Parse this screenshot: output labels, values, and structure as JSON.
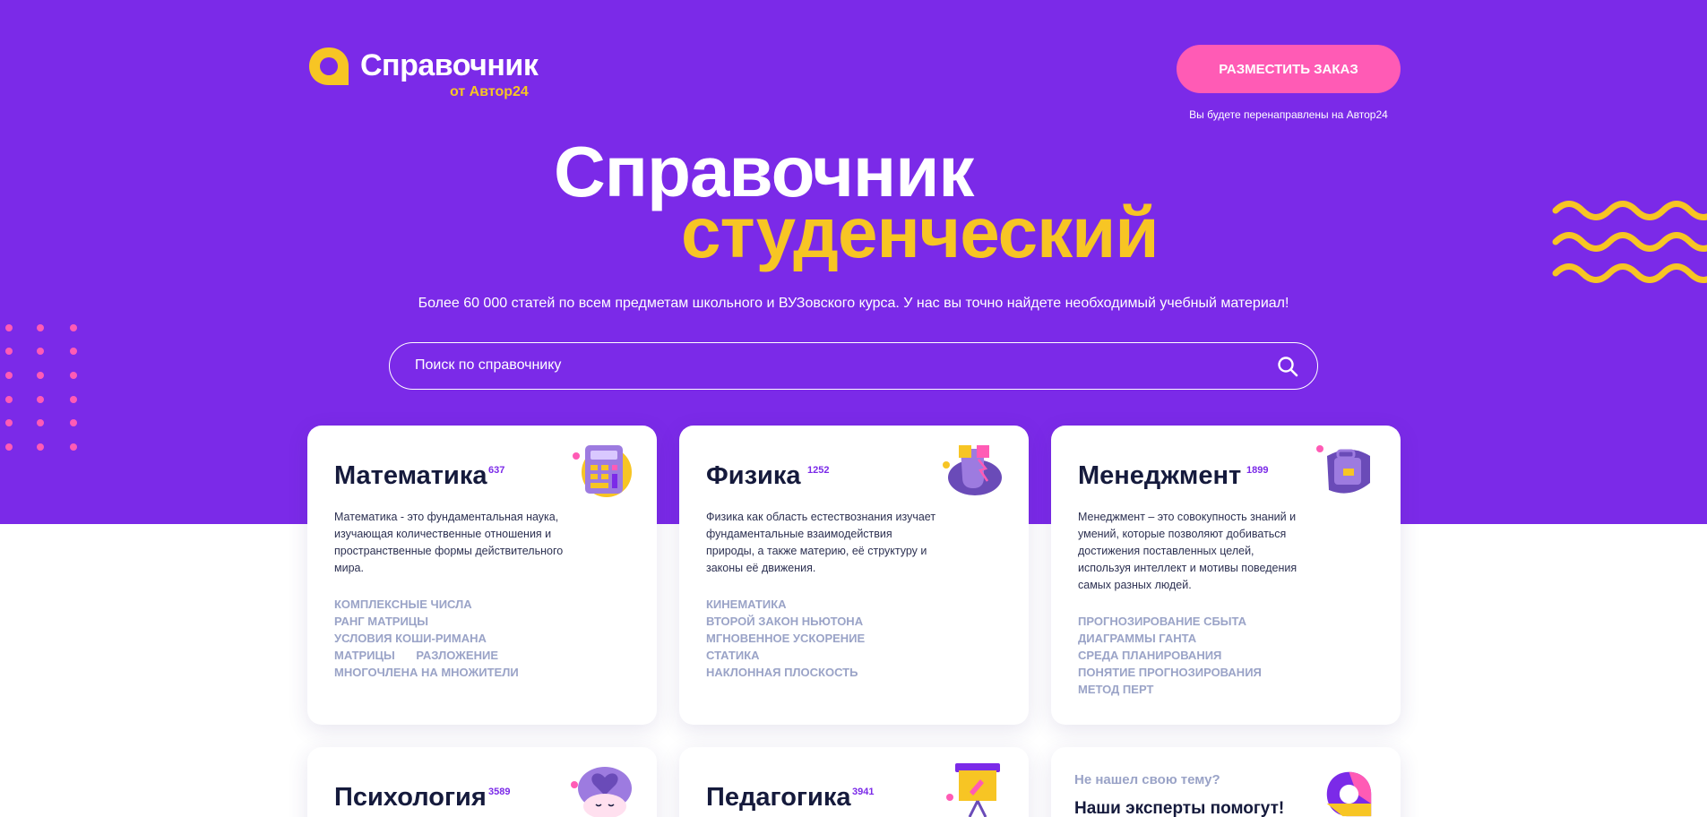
{
  "header": {
    "logo_title": "Справочник",
    "logo_subtitle": "от Автор24",
    "order_button": "РАЗМЕСТИТЬ ЗАКАЗ",
    "order_note": "Вы будете перенаправлены на Автор24"
  },
  "hero": {
    "title_line1": "Справочник",
    "title_line2": "студенческий",
    "lead": "Более 60 000 статей по всем предметам школьного и ВУЗовского курса. У нас вы точно найдете необходимый учебный материал!"
  },
  "search": {
    "placeholder": "Поиск по справочнику",
    "icon": "search-icon"
  },
  "colors": {
    "brand_purple": "#7b2ae8",
    "accent_yellow": "#f7c524",
    "accent_pink": "#ff5bb5",
    "tag_color": "#9aa3c7"
  },
  "cards": [
    {
      "title": "Математика",
      "count": "637",
      "description": "Математика - это фундаментальная наука, изучающая количественные отношения и пространственные формы действительного мира.",
      "tags": [
        "КОМПЛЕКСНЫЕ ЧИСЛА",
        "РАНГ МАТРИЦЫ",
        "УСЛОВИЯ КОШИ-РИМАНА",
        "МАТРИЦЫ",
        "РАЗЛОЖЕНИЕ МНОГОЧЛЕНА НА МНОЖИТЕЛИ"
      ],
      "icon": "calculator-icon"
    },
    {
      "title": "Физика",
      "count": "1252",
      "description": "Физика как область естествознания изучает фундаментальные взаимодействия природы, а также материю, её структуру и законы её движения.",
      "tags": [
        "КИНЕМАТИКА",
        "ВТОРОЙ ЗАКОН НЬЮТОНА",
        "МГНОВЕННОЕ УСКОРЕНИЕ",
        "СТАТИКА",
        "НАКЛОННАЯ ПЛОСКОСТЬ"
      ],
      "icon": "magnet-icon"
    },
    {
      "title": "Менеджмент",
      "count": "1899",
      "description": "Менеджмент – это совокупность знаний и умений, которые позволяют добиваться достижения поставленных целей, используя интеллект и мотивы поведения самых разных людей.",
      "tags": [
        "ПРОГНОЗИРОВАНИЕ СБЫТА",
        "ДИАГРАММЫ ГАНТА",
        "СРЕДА ПЛАНИРОВАНИЯ",
        "ПОНЯТИЕ ПРОГНОЗИРОВАНИЯ",
        "МЕТОД ПЕРТ"
      ],
      "icon": "briefcase-icon"
    },
    {
      "title": "Психология",
      "count": "3589",
      "icon": "brain-heart-icon"
    },
    {
      "title": "Педагогика",
      "count": "3941",
      "icon": "presentation-board-icon"
    }
  ],
  "cta": {
    "question": "Не нашел свою тему?",
    "heading": "Наши эксперты помогут!",
    "icon": "author24-logo-icon"
  }
}
